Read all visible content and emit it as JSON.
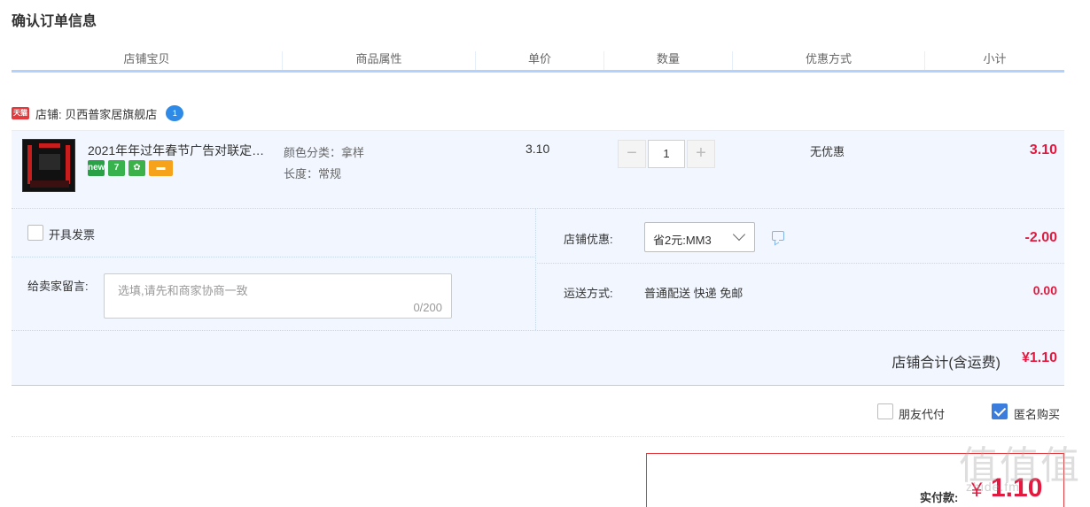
{
  "page": {
    "title": "确认订单信息"
  },
  "table_header": {
    "columns": [
      "店铺宝贝",
      "商品属性",
      "单价",
      "数量",
      "优惠方式",
      "小计"
    ]
  },
  "shop": {
    "badge": "天猫",
    "label": "店铺: 贝西普家居旗舰店",
    "chat_icon_text": "1"
  },
  "item": {
    "name": "2021年年过年春节广告对联定…",
    "attributes": [
      "颜色分类：拿样",
      "长度：常规"
    ],
    "unit_price": "3.10",
    "quantity": "1",
    "quantity_minus": "−",
    "quantity_plus": "+",
    "discount": "无优惠",
    "subtotal": "3.10",
    "badges": [
      "new",
      "7",
      "✿",
      "▬"
    ]
  },
  "invoice": {
    "label": "开具发票",
    "checked": false
  },
  "message": {
    "label": "给卖家留言:",
    "placeholder": "选填,请先和商家协商一致",
    "counter": "0/200"
  },
  "promotion": {
    "label": "店铺优惠:",
    "selected": "省2元:MM3",
    "amount": "-2.00"
  },
  "shipping": {
    "label": "运送方式:",
    "value": "普通配送 快递 免邮",
    "amount": "0.00"
  },
  "shop_total": {
    "label": "店铺合计(含运费)",
    "amount": "¥1.10"
  },
  "options": {
    "friend_pay": {
      "label": "朋友代付",
      "checked": false
    },
    "anonymous": {
      "label": "匿名购买",
      "checked": true
    }
  },
  "payment": {
    "label": "实付款:",
    "symbol": "¥",
    "amount": "1.10"
  },
  "watermark": {
    "chars": "值值值",
    "site": "zhide.fm"
  },
  "colors": {
    "accent_red": "#e4193f",
    "header_underline": "#b2d1ff",
    "row_bg": "#f2f7ff",
    "checkbox_blue": "#3b7ddd"
  }
}
